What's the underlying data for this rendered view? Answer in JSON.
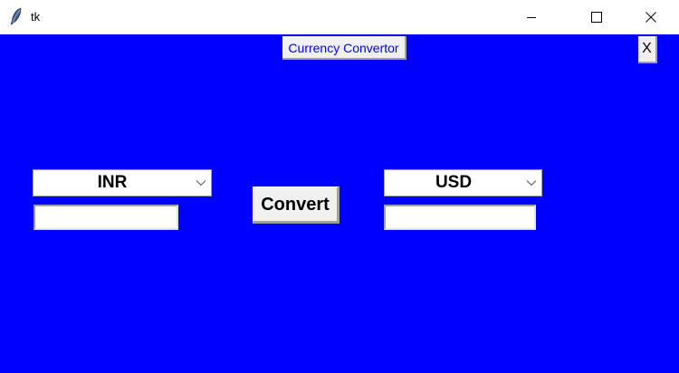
{
  "window": {
    "title": "tk",
    "icons": {
      "app": "feather-icon",
      "minimize": "minimize-icon",
      "maximize": "maximize-icon",
      "close": "close-icon"
    }
  },
  "app": {
    "background_color": "#0000ff",
    "header_label": "Currency Convertor",
    "header_label_color": "#0000ff",
    "close_button_label": "X",
    "from_currency": {
      "selected": "INR",
      "amount": ""
    },
    "to_currency": {
      "selected": "USD",
      "amount": ""
    },
    "convert_button_label": "Convert"
  }
}
